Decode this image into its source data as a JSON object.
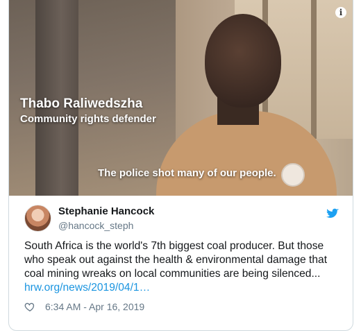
{
  "video": {
    "name_caption": "Thabo Raliwedszha",
    "role_caption": "Community rights defender",
    "quote_caption": "The police shot many of our people.",
    "info_glyph": "i"
  },
  "tweet": {
    "author_name": "Stephanie Hancock",
    "author_handle": "@hancock_steph",
    "text_line1": "South Africa is the world's 7th biggest coal producer. But those",
    "text_line2": "who speak out against the health & environmental damage that",
    "text_line3": "coal mining wreaks on local communities are being silenced...",
    "link_text": "hrw.org/news/2019/04/1…",
    "timestamp": "6:34 AM - Apr 16, 2019",
    "icons": {
      "like": "heart-icon",
      "brand": "twitter-bird-icon"
    },
    "colors": {
      "link": "#1b95e0",
      "brand": "#1da1f2",
      "secondary": "#657786"
    }
  }
}
